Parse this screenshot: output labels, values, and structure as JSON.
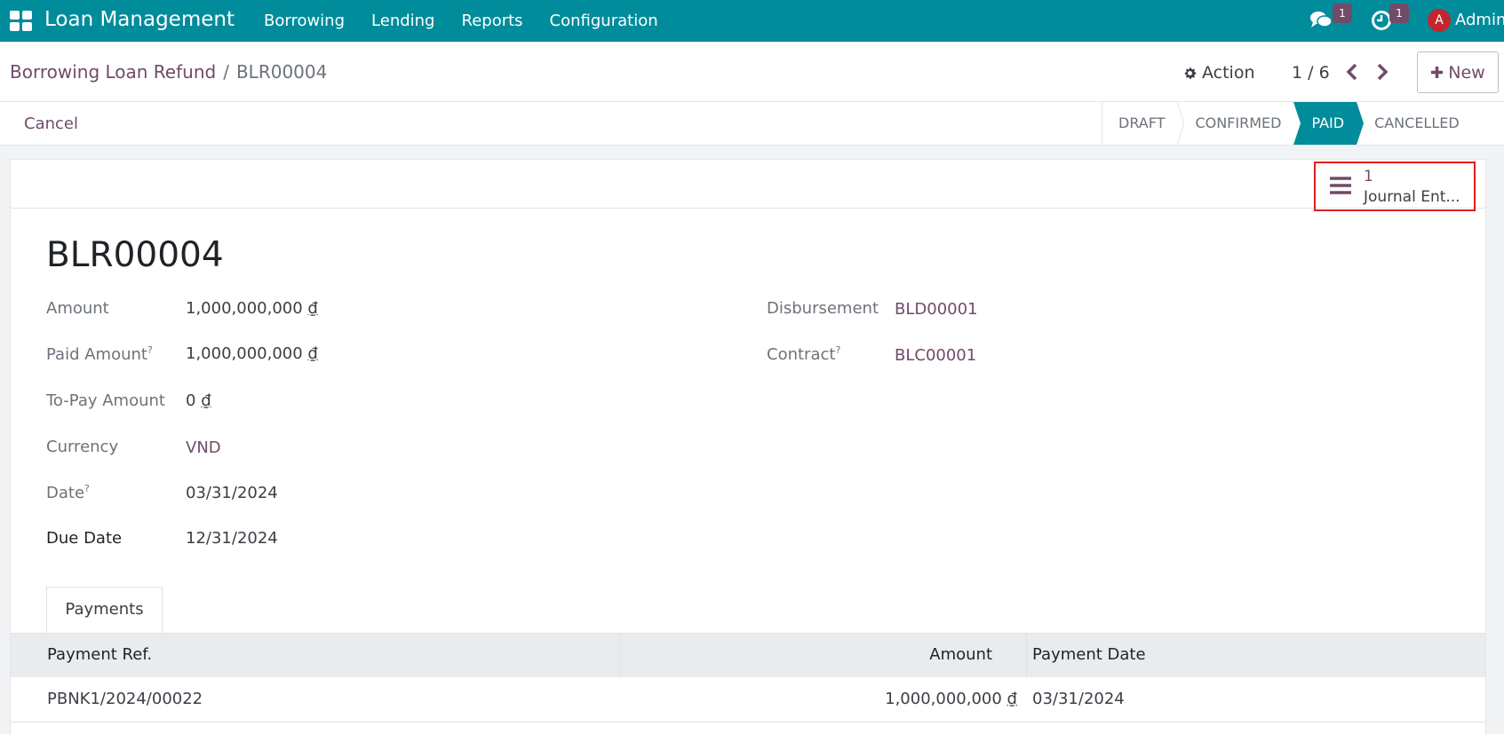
{
  "navbar": {
    "app_name": "Loan Management",
    "menu": [
      "Borrowing",
      "Lending",
      "Reports",
      "Configuration"
    ],
    "messages_count": "1",
    "activities_count": "1",
    "avatar_initial": "A",
    "user_name": "Admin"
  },
  "control": {
    "breadcrumb_parent": "Borrowing Loan Refund",
    "breadcrumb_separator": "/",
    "breadcrumb_current": "BLR00004",
    "action_label": "Action",
    "pager": "1 / 6",
    "new_label": "New"
  },
  "status": {
    "cancel_label": "Cancel",
    "stages": [
      "DRAFT",
      "CONFIRMED",
      "PAID",
      "CANCELLED"
    ],
    "active_stage": "PAID"
  },
  "smart_button": {
    "count": "1",
    "label": "Journal Ent..."
  },
  "record": {
    "title": "BLR00004",
    "left_fields": [
      {
        "label": "Amount",
        "value": "1,000,000,000",
        "currency": "₫",
        "help": ""
      },
      {
        "label": "Paid Amount",
        "value": "1,000,000,000",
        "currency": "₫",
        "help": "?"
      },
      {
        "label": "To-Pay Amount",
        "value": "0",
        "currency": "₫",
        "help": ""
      },
      {
        "label": "Currency",
        "value": "VND",
        "currency": "",
        "help": ""
      },
      {
        "label": "Date",
        "value": "03/31/2024",
        "currency": "",
        "help": "?"
      },
      {
        "label": "Due Date",
        "value": "12/31/2024",
        "currency": "",
        "help": ""
      }
    ],
    "right_fields": [
      {
        "label": "Disbursement",
        "value": "BLD00001",
        "help": ""
      },
      {
        "label": "Contract",
        "value": "BLC00001",
        "help": "?"
      }
    ]
  },
  "tabs": [
    "Payments"
  ],
  "payments": {
    "columns": [
      "Payment Ref.",
      "Amount",
      "Payment Date"
    ],
    "rows": [
      {
        "ref": "PBNK1/2024/00022",
        "amount": "1,000,000,000",
        "currency": "₫",
        "date": "03/31/2024"
      }
    ]
  },
  "colors": {
    "navbar": "#008c9b",
    "brand_link": "#714b67",
    "highlight_border": "#e01e1e"
  }
}
